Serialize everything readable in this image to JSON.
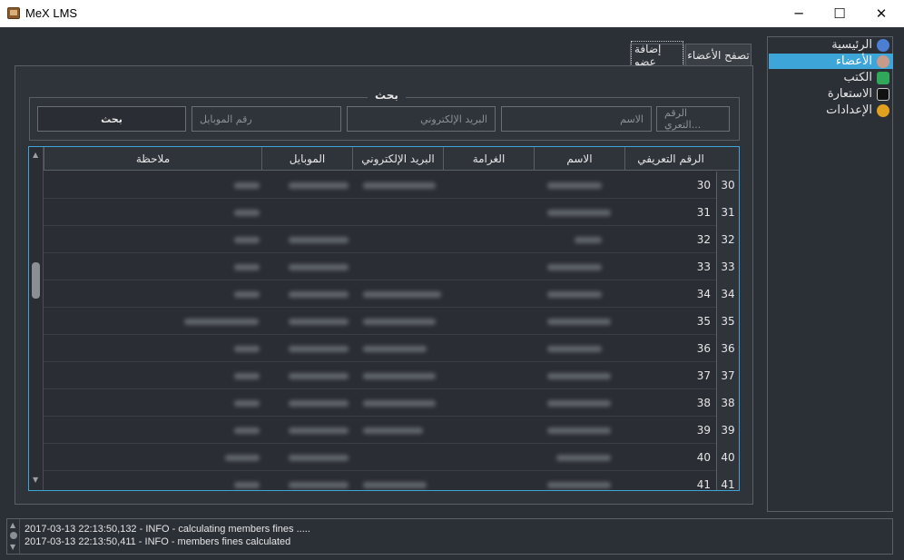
{
  "window": {
    "title": "MeX LMS",
    "min_glyph": "─",
    "max_glyph": "☐",
    "close_glyph": "✕"
  },
  "tabs": [
    {
      "label": "تصفح الأعضاء"
    },
    {
      "label": "إضافة عضو"
    }
  ],
  "search": {
    "legend": "بحث",
    "id_placeholder": "الرقم التعري...",
    "name_placeholder": "الاسم",
    "email_placeholder": "البريد الإلكتروني",
    "mobile_placeholder": "رقم الموبايل",
    "button_label": "بحث"
  },
  "table": {
    "headers": {
      "id": "الرقم التعريفي",
      "name": "الاسم",
      "fine": "الغرامة",
      "email": "البريد الإلكتروني",
      "mobile": "الموبايل",
      "note": "ملاحظة"
    },
    "rows": [
      {
        "row_number": "30",
        "id": "30"
      },
      {
        "row_number": "31",
        "id": "31"
      },
      {
        "row_number": "32",
        "id": "32"
      },
      {
        "row_number": "33",
        "id": "33"
      },
      {
        "row_number": "34",
        "id": "34"
      },
      {
        "row_number": "35",
        "id": "35"
      },
      {
        "row_number": "36",
        "id": "36"
      },
      {
        "row_number": "37",
        "id": "37"
      },
      {
        "row_number": "38",
        "id": "38"
      },
      {
        "row_number": "39",
        "id": "39"
      },
      {
        "row_number": "40",
        "id": "40"
      },
      {
        "row_number": "41",
        "id": "41"
      }
    ]
  },
  "sidebar": {
    "items": [
      {
        "label": "الرئيسية",
        "icon": "home-icon"
      },
      {
        "label": "الأعضاء",
        "icon": "users-icon",
        "active": true
      },
      {
        "label": "الكتب",
        "icon": "books-icon"
      },
      {
        "label": "الاستعارة",
        "icon": "borrow-icon"
      },
      {
        "label": "الإعدادات",
        "icon": "settings-icon"
      }
    ]
  },
  "log": {
    "lines": [
      "2017-03-13 22:13:50,132 - INFO - calculating members fines .....",
      "2017-03-13 22:13:50,411 - INFO - members fines calculated"
    ]
  }
}
